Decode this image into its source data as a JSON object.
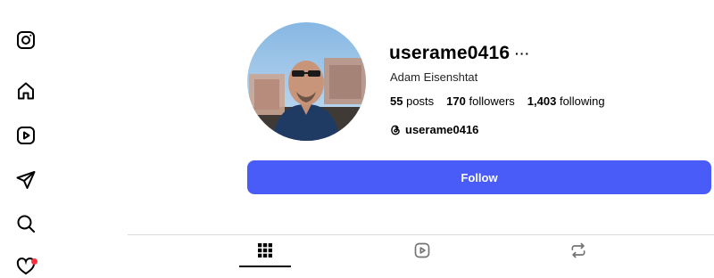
{
  "sidebar": {
    "items": [
      {
        "name": "instagram-logo-icon"
      },
      {
        "name": "home-icon"
      },
      {
        "name": "reels-icon"
      },
      {
        "name": "messages-icon"
      },
      {
        "name": "search-icon"
      },
      {
        "name": "notifications-icon",
        "badge_color": "#ff3040"
      }
    ]
  },
  "profile": {
    "username": "userame0416",
    "more_label": "···",
    "full_name": "Adam Eisenshtat",
    "stats": {
      "posts_count": "55",
      "posts_label": "posts",
      "followers_count": "170",
      "followers_label": "followers",
      "following_count": "1,403",
      "following_label": "following"
    },
    "threads_handle": "userame0416"
  },
  "actions": {
    "follow_label": "Follow",
    "follow_color": "#4a5cf7"
  },
  "tabs": [
    {
      "name": "posts-grid-icon",
      "active": true
    },
    {
      "name": "reels-icon",
      "active": false
    },
    {
      "name": "reposts-icon",
      "active": false
    }
  ]
}
